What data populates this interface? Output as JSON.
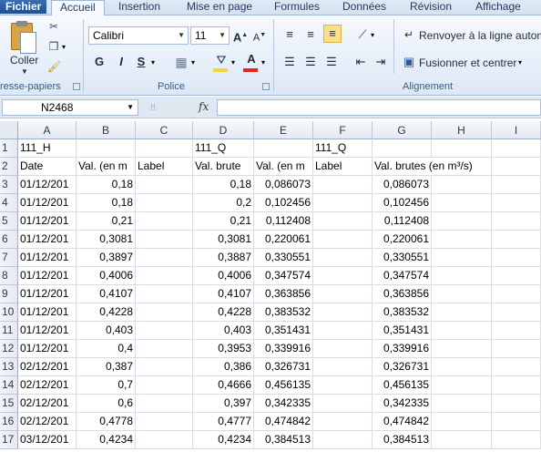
{
  "tabs": [
    "Fichier",
    "Accueil",
    "Insertion",
    "Mise en page",
    "Formules",
    "Données",
    "Révision",
    "Affichage"
  ],
  "clipboard": {
    "paste_label": "Coller",
    "group_label": "resse-papiers"
  },
  "font": {
    "name": "Calibri",
    "size": "11",
    "group_label": "Police",
    "bold": "G",
    "italic": "I",
    "underline": "S"
  },
  "alignment": {
    "wrap_label": "Renvoyer à la ligne autom",
    "merge_label": "Fusionner et centrer",
    "group_label": "Alignement"
  },
  "formula_bar": {
    "name_box": "N2468",
    "fx": "fx",
    "formula": ""
  },
  "columns": [
    "A",
    "B",
    "C",
    "D",
    "E",
    "F",
    "G",
    "H",
    "I"
  ],
  "rows": [
    [
      "1",
      "111_H",
      "",
      "",
      "111_Q",
      "",
      "111_Q",
      "",
      ""
    ],
    [
      "2",
      "Date",
      "Val. (en m",
      "Label",
      "Val. brute",
      "Val. (en m",
      "Label",
      "Val. brutes (en m³/s)",
      ""
    ],
    [
      "3",
      "01/12/201",
      "0,18",
      "",
      "0,18",
      "0,086073",
      "",
      "0,086073",
      ""
    ],
    [
      "4",
      "01/12/201",
      "0,18",
      "",
      "0,2",
      "0,102456",
      "",
      "0,102456",
      ""
    ],
    [
      "5",
      "01/12/201",
      "0,21",
      "",
      "0,21",
      "0,112408",
      "",
      "0,112408",
      ""
    ],
    [
      "6",
      "01/12/201",
      "0,3081",
      "",
      "0,3081",
      "0,220061",
      "",
      "0,220061",
      ""
    ],
    [
      "7",
      "01/12/201",
      "0,3897",
      "",
      "0,3887",
      "0,330551",
      "",
      "0,330551",
      ""
    ],
    [
      "8",
      "01/12/201",
      "0,4006",
      "",
      "0,4006",
      "0,347574",
      "",
      "0,347574",
      ""
    ],
    [
      "9",
      "01/12/201",
      "0,4107",
      "",
      "0,4107",
      "0,363856",
      "",
      "0,363856",
      ""
    ],
    [
      "10",
      "01/12/201",
      "0,4228",
      "",
      "0,4228",
      "0,383532",
      "",
      "0,383532",
      ""
    ],
    [
      "11",
      "01/12/201",
      "0,403",
      "",
      "0,403",
      "0,351431",
      "",
      "0,351431",
      ""
    ],
    [
      "12",
      "01/12/201",
      "0,4",
      "",
      "0,3953",
      "0,339916",
      "",
      "0,339916",
      ""
    ],
    [
      "13",
      "02/12/201",
      "0,387",
      "",
      "0,386",
      "0,326731",
      "",
      "0,326731",
      ""
    ],
    [
      "14",
      "02/12/201",
      "0,7",
      "",
      "0,4666",
      "0,456135",
      "",
      "0,456135",
      ""
    ],
    [
      "15",
      "02/12/201",
      "0,6",
      "",
      "0,397",
      "0,342335",
      "",
      "0,342335",
      ""
    ],
    [
      "16",
      "02/12/201",
      "0,4778",
      "",
      "0,4777",
      "0,474842",
      "",
      "0,474842",
      ""
    ],
    [
      "17",
      "03/12/201",
      "0,4234",
      "",
      "0,4234",
      "0,384513",
      "",
      "0,384513",
      ""
    ]
  ],
  "colors": {
    "font_color": "#e3261a",
    "highlight": "#f6d33a",
    "wrap_active": "#fbe08a"
  }
}
